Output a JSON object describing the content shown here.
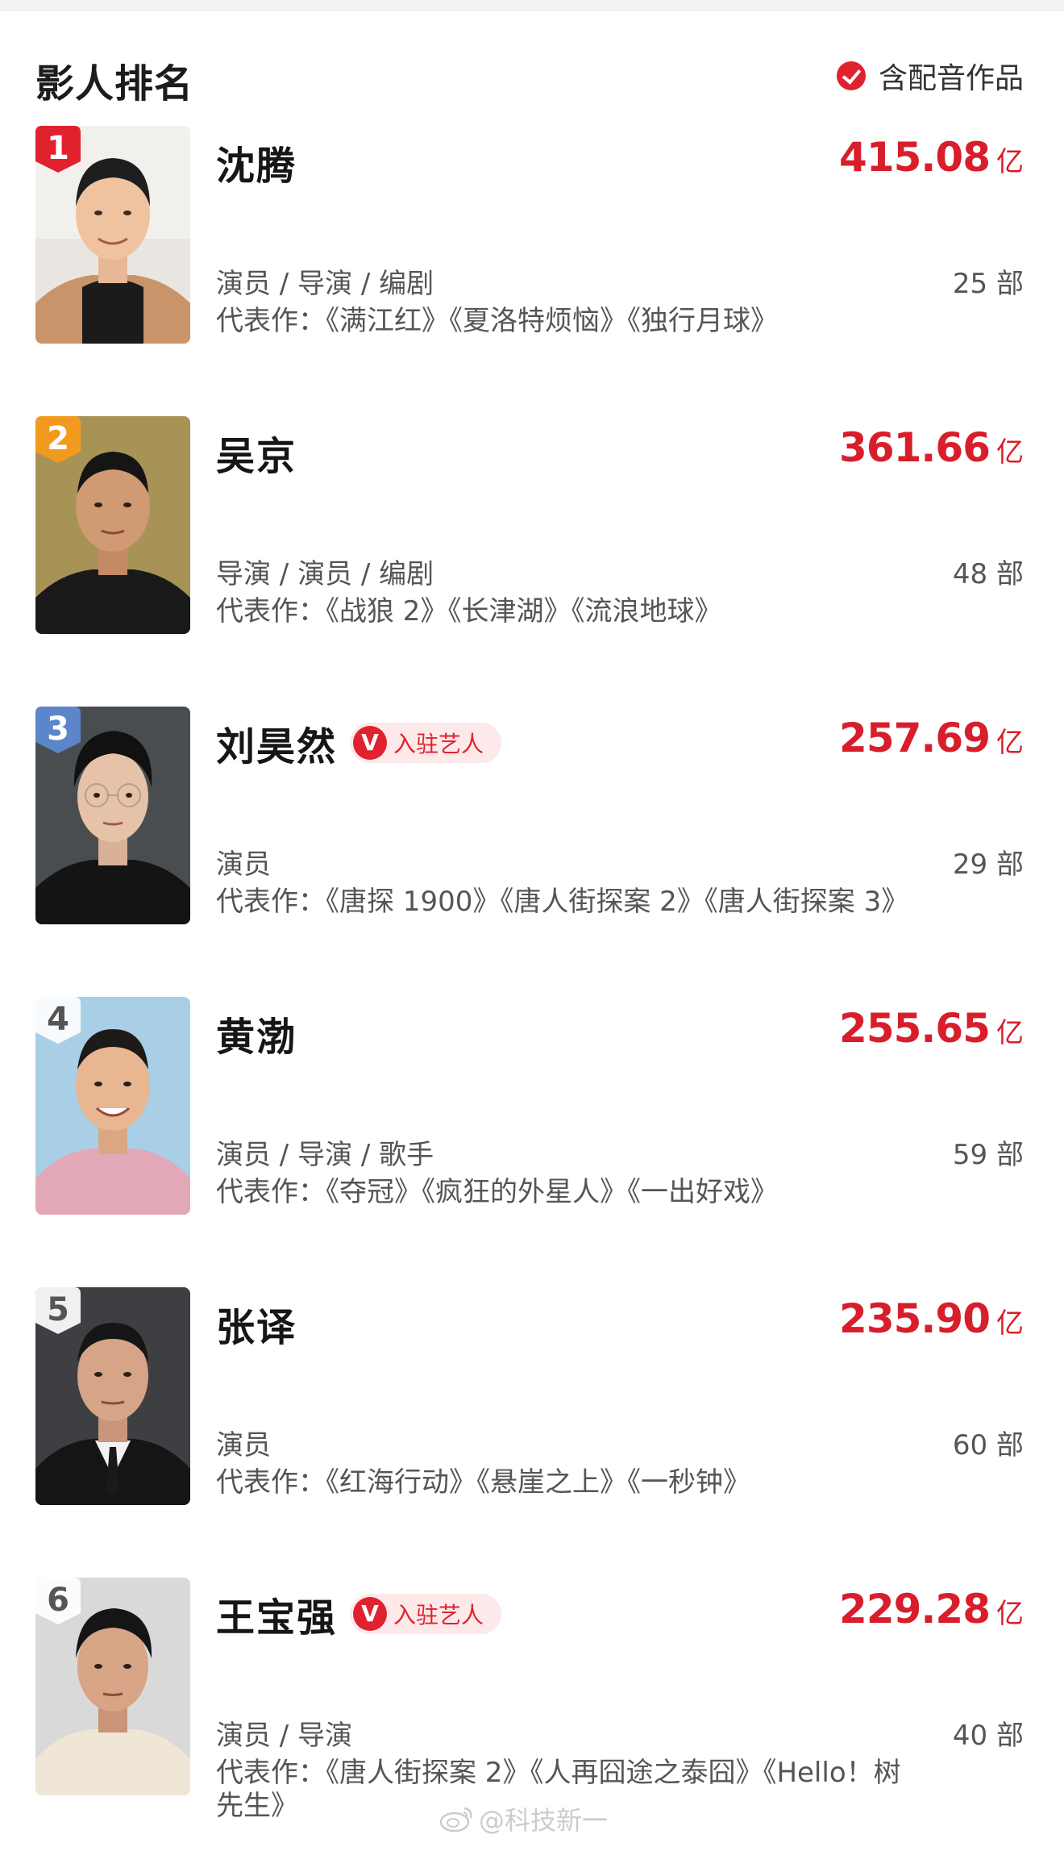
{
  "header": {
    "title": "影人排名",
    "filter_label": "含配音作品"
  },
  "colors": {
    "accent": "#d81e2b",
    "rank_1": "#e0222f",
    "rank_2": "#f29a1e",
    "rank_3": "#5b86c9",
    "verified_bg": "#fde9ea"
  },
  "rankings": [
    {
      "rank": "1",
      "name": "沈腾",
      "box_office": "415.08",
      "unit": "亿",
      "roles": "演员 / 导演 / 编剧",
      "count": "25 部",
      "works": "代表作：《满江红》《夏洛特烦恼》《独行月球》"
    },
    {
      "rank": "2",
      "name": "吴京",
      "box_office": "361.66",
      "unit": "亿",
      "roles": "导演 / 演员 / 编剧",
      "count": "48 部",
      "works": "代表作：《战狼 2》《长津湖》《流浪地球》"
    },
    {
      "rank": "3",
      "name": "刘昊然",
      "verified": "入驻艺人",
      "box_office": "257.69",
      "unit": "亿",
      "roles": "演员",
      "count": "29 部",
      "works": "代表作：《唐探 1900》《唐人街探案 2》《唐人街探案 3》"
    },
    {
      "rank": "4",
      "name": "黄渤",
      "box_office": "255.65",
      "unit": "亿",
      "roles": "演员 / 导演 / 歌手",
      "count": "59 部",
      "works": "代表作：《夺冠》《疯狂的外星人》《一出好戏》"
    },
    {
      "rank": "5",
      "name": "张译",
      "box_office": "235.90",
      "unit": "亿",
      "roles": "演员",
      "count": "60 部",
      "works": "代表作：《红海行动》《悬崖之上》《一秒钟》"
    },
    {
      "rank": "6",
      "name": "王宝强",
      "verified": "入驻艺人",
      "box_office": "229.28",
      "unit": "亿",
      "roles": "演员 / 导演",
      "count": "40 部",
      "works": "代表作：《唐人街探案 2》《人再囧途之泰囧》《Hello！树先生》"
    }
  ],
  "watermark": "@科技新一"
}
